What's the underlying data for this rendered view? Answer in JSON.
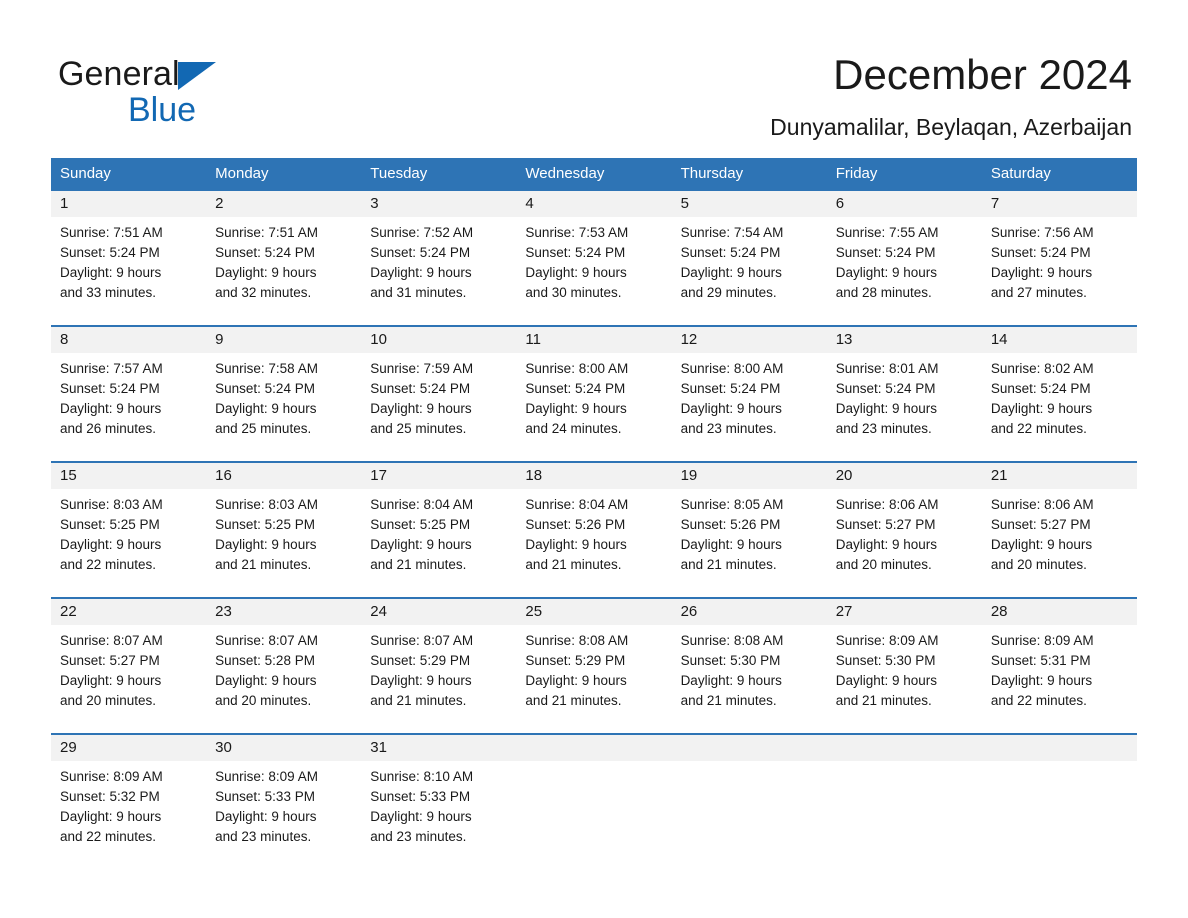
{
  "brand": {
    "word_general": "General",
    "word_blue": "Blue",
    "accent_color": "#1268b3"
  },
  "header": {
    "title": "December 2024",
    "subtitle": "Dunyamalilar, Beylaqan, Azerbaijan",
    "header_bg_color": "#2e74b5",
    "daynum_bg_color": "#f2f2f2"
  },
  "calendar": {
    "weekday_headers": [
      "Sunday",
      "Monday",
      "Tuesday",
      "Wednesday",
      "Thursday",
      "Friday",
      "Saturday"
    ],
    "weeks": [
      [
        {
          "day": "1",
          "sunrise": "Sunrise: 7:51 AM",
          "sunset": "Sunset: 5:24 PM",
          "daylight1": "Daylight: 9 hours",
          "daylight2": "and 33 minutes."
        },
        {
          "day": "2",
          "sunrise": "Sunrise: 7:51 AM",
          "sunset": "Sunset: 5:24 PM",
          "daylight1": "Daylight: 9 hours",
          "daylight2": "and 32 minutes."
        },
        {
          "day": "3",
          "sunrise": "Sunrise: 7:52 AM",
          "sunset": "Sunset: 5:24 PM",
          "daylight1": "Daylight: 9 hours",
          "daylight2": "and 31 minutes."
        },
        {
          "day": "4",
          "sunrise": "Sunrise: 7:53 AM",
          "sunset": "Sunset: 5:24 PM",
          "daylight1": "Daylight: 9 hours",
          "daylight2": "and 30 minutes."
        },
        {
          "day": "5",
          "sunrise": "Sunrise: 7:54 AM",
          "sunset": "Sunset: 5:24 PM",
          "daylight1": "Daylight: 9 hours",
          "daylight2": "and 29 minutes."
        },
        {
          "day": "6",
          "sunrise": "Sunrise: 7:55 AM",
          "sunset": "Sunset: 5:24 PM",
          "daylight1": "Daylight: 9 hours",
          "daylight2": "and 28 minutes."
        },
        {
          "day": "7",
          "sunrise": "Sunrise: 7:56 AM",
          "sunset": "Sunset: 5:24 PM",
          "daylight1": "Daylight: 9 hours",
          "daylight2": "and 27 minutes."
        }
      ],
      [
        {
          "day": "8",
          "sunrise": "Sunrise: 7:57 AM",
          "sunset": "Sunset: 5:24 PM",
          "daylight1": "Daylight: 9 hours",
          "daylight2": "and 26 minutes."
        },
        {
          "day": "9",
          "sunrise": "Sunrise: 7:58 AM",
          "sunset": "Sunset: 5:24 PM",
          "daylight1": "Daylight: 9 hours",
          "daylight2": "and 25 minutes."
        },
        {
          "day": "10",
          "sunrise": "Sunrise: 7:59 AM",
          "sunset": "Sunset: 5:24 PM",
          "daylight1": "Daylight: 9 hours",
          "daylight2": "and 25 minutes."
        },
        {
          "day": "11",
          "sunrise": "Sunrise: 8:00 AM",
          "sunset": "Sunset: 5:24 PM",
          "daylight1": "Daylight: 9 hours",
          "daylight2": "and 24 minutes."
        },
        {
          "day": "12",
          "sunrise": "Sunrise: 8:00 AM",
          "sunset": "Sunset: 5:24 PM",
          "daylight1": "Daylight: 9 hours",
          "daylight2": "and 23 minutes."
        },
        {
          "day": "13",
          "sunrise": "Sunrise: 8:01 AM",
          "sunset": "Sunset: 5:24 PM",
          "daylight1": "Daylight: 9 hours",
          "daylight2": "and 23 minutes."
        },
        {
          "day": "14",
          "sunrise": "Sunrise: 8:02 AM",
          "sunset": "Sunset: 5:24 PM",
          "daylight1": "Daylight: 9 hours",
          "daylight2": "and 22 minutes."
        }
      ],
      [
        {
          "day": "15",
          "sunrise": "Sunrise: 8:03 AM",
          "sunset": "Sunset: 5:25 PM",
          "daylight1": "Daylight: 9 hours",
          "daylight2": "and 22 minutes."
        },
        {
          "day": "16",
          "sunrise": "Sunrise: 8:03 AM",
          "sunset": "Sunset: 5:25 PM",
          "daylight1": "Daylight: 9 hours",
          "daylight2": "and 21 minutes."
        },
        {
          "day": "17",
          "sunrise": "Sunrise: 8:04 AM",
          "sunset": "Sunset: 5:25 PM",
          "daylight1": "Daylight: 9 hours",
          "daylight2": "and 21 minutes."
        },
        {
          "day": "18",
          "sunrise": "Sunrise: 8:04 AM",
          "sunset": "Sunset: 5:26 PM",
          "daylight1": "Daylight: 9 hours",
          "daylight2": "and 21 minutes."
        },
        {
          "day": "19",
          "sunrise": "Sunrise: 8:05 AM",
          "sunset": "Sunset: 5:26 PM",
          "daylight1": "Daylight: 9 hours",
          "daylight2": "and 21 minutes."
        },
        {
          "day": "20",
          "sunrise": "Sunrise: 8:06 AM",
          "sunset": "Sunset: 5:27 PM",
          "daylight1": "Daylight: 9 hours",
          "daylight2": "and 20 minutes."
        },
        {
          "day": "21",
          "sunrise": "Sunrise: 8:06 AM",
          "sunset": "Sunset: 5:27 PM",
          "daylight1": "Daylight: 9 hours",
          "daylight2": "and 20 minutes."
        }
      ],
      [
        {
          "day": "22",
          "sunrise": "Sunrise: 8:07 AM",
          "sunset": "Sunset: 5:27 PM",
          "daylight1": "Daylight: 9 hours",
          "daylight2": "and 20 minutes."
        },
        {
          "day": "23",
          "sunrise": "Sunrise: 8:07 AM",
          "sunset": "Sunset: 5:28 PM",
          "daylight1": "Daylight: 9 hours",
          "daylight2": "and 20 minutes."
        },
        {
          "day": "24",
          "sunrise": "Sunrise: 8:07 AM",
          "sunset": "Sunset: 5:29 PM",
          "daylight1": "Daylight: 9 hours",
          "daylight2": "and 21 minutes."
        },
        {
          "day": "25",
          "sunrise": "Sunrise: 8:08 AM",
          "sunset": "Sunset: 5:29 PM",
          "daylight1": "Daylight: 9 hours",
          "daylight2": "and 21 minutes."
        },
        {
          "day": "26",
          "sunrise": "Sunrise: 8:08 AM",
          "sunset": "Sunset: 5:30 PM",
          "daylight1": "Daylight: 9 hours",
          "daylight2": "and 21 minutes."
        },
        {
          "day": "27",
          "sunrise": "Sunrise: 8:09 AM",
          "sunset": "Sunset: 5:30 PM",
          "daylight1": "Daylight: 9 hours",
          "daylight2": "and 21 minutes."
        },
        {
          "day": "28",
          "sunrise": "Sunrise: 8:09 AM",
          "sunset": "Sunset: 5:31 PM",
          "daylight1": "Daylight: 9 hours",
          "daylight2": "and 22 minutes."
        }
      ],
      [
        {
          "day": "29",
          "sunrise": "Sunrise: 8:09 AM",
          "sunset": "Sunset: 5:32 PM",
          "daylight1": "Daylight: 9 hours",
          "daylight2": "and 22 minutes."
        },
        {
          "day": "30",
          "sunrise": "Sunrise: 8:09 AM",
          "sunset": "Sunset: 5:33 PM",
          "daylight1": "Daylight: 9 hours",
          "daylight2": "and 23 minutes."
        },
        {
          "day": "31",
          "sunrise": "Sunrise: 8:10 AM",
          "sunset": "Sunset: 5:33 PM",
          "daylight1": "Daylight: 9 hours",
          "daylight2": "and 23 minutes."
        },
        {
          "day": "",
          "sunrise": "",
          "sunset": "",
          "daylight1": "",
          "daylight2": ""
        },
        {
          "day": "",
          "sunrise": "",
          "sunset": "",
          "daylight1": "",
          "daylight2": ""
        },
        {
          "day": "",
          "sunrise": "",
          "sunset": "",
          "daylight1": "",
          "daylight2": ""
        },
        {
          "day": "",
          "sunrise": "",
          "sunset": "",
          "daylight1": "",
          "daylight2": ""
        }
      ]
    ]
  }
}
